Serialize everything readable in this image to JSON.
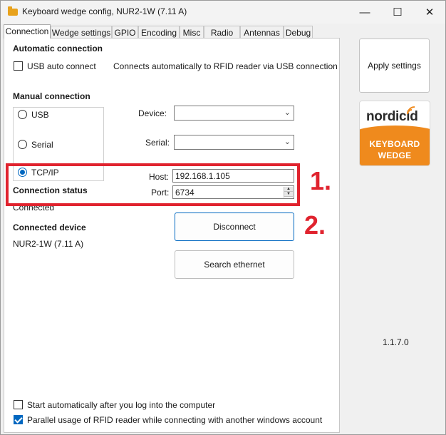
{
  "window": {
    "title": "Keyboard wedge config, NUR2-1W  (7.11 A)",
    "controls": {
      "minimize": "—",
      "maximize": "☐",
      "close": "✕"
    }
  },
  "tabs": [
    {
      "label": "Connection",
      "active": true
    },
    {
      "label": "Wedge settings"
    },
    {
      "label": "GPIO"
    },
    {
      "label": "Encoding"
    },
    {
      "label": "Misc"
    },
    {
      "label": "Radio"
    },
    {
      "label": "Antennas"
    },
    {
      "label": "Debug"
    }
  ],
  "automatic": {
    "heading": "Automatic connection",
    "usb_label": "USB auto connect",
    "usb_checked": false,
    "description": "Connects automatically to RFID reader via USB connection"
  },
  "manual": {
    "heading": "Manual connection",
    "options": [
      {
        "label": "USB",
        "selected": false
      },
      {
        "label": "Serial",
        "selected": false
      },
      {
        "label": "TCP/IP",
        "selected": true
      }
    ],
    "device_label": "Device:",
    "serial_label": "Serial:",
    "host_label": "Host:",
    "host_value": "192.168.1.105",
    "port_label": "Port:",
    "port_value": "6734"
  },
  "status": {
    "heading": "Connection status",
    "value": "Connected"
  },
  "device": {
    "heading": "Connected device",
    "value": "NUR2-1W  (7.11 A)"
  },
  "buttons": {
    "disconnect": "Disconnect",
    "search": "Search ethernet",
    "apply": "Apply settings"
  },
  "logo": {
    "word": "nordic",
    "word_suffix": "id",
    "line1": "KEYBOARD",
    "line2": "WEDGE"
  },
  "version": "1.1.7.0",
  "footer": {
    "autostart_label": "Start automatically after you log into the computer",
    "autostart_checked": false,
    "parallel_label": "Parallel usage of RFID reader while connecting with another windows account",
    "parallel_checked": true
  },
  "annotations": {
    "one": "1.",
    "two": "2."
  },
  "colors": {
    "accent": "#0067c0",
    "annotation_red": "#e0232e",
    "brand_orange": "#ef8a1d"
  }
}
